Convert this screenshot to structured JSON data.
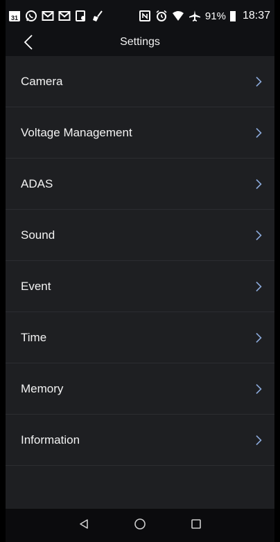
{
  "status_bar": {
    "icons_left": [
      "calendar-icon",
      "whatsapp-icon",
      "gmail-icon",
      "gmail-icon",
      "cast-icon",
      "broom-icon"
    ],
    "icons_right": [
      "nfc-icon",
      "alarm-icon",
      "wifi-icon",
      "airplane-icon"
    ],
    "calendar_day": "31",
    "battery": "91%",
    "time": "18:37"
  },
  "app_bar": {
    "title": "Settings",
    "back_icon": "chevron-left-icon"
  },
  "settings": {
    "items": [
      {
        "label": "Camera"
      },
      {
        "label": "Voltage Management"
      },
      {
        "label": "ADAS"
      },
      {
        "label": "Sound"
      },
      {
        "label": "Event"
      },
      {
        "label": "Time"
      },
      {
        "label": "Memory"
      },
      {
        "label": "Information"
      }
    ]
  },
  "nav_bar": {
    "buttons": [
      "back-triangle-icon",
      "home-circle-icon",
      "recents-square-icon"
    ]
  },
  "colors": {
    "background": "#1e1f22",
    "header": "#101114",
    "divider": "#2c2d31",
    "chevron": "#8aa8d8",
    "text": "#f3f3f3"
  }
}
